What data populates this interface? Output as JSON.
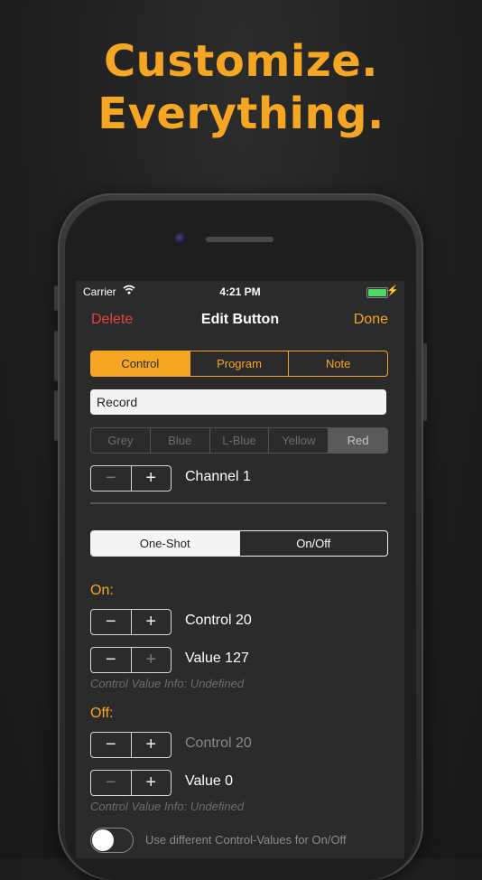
{
  "headline": {
    "line1": "Customize.",
    "line2": "Everything."
  },
  "status_bar": {
    "carrier": "Carrier",
    "time": "4:21 PM"
  },
  "nav": {
    "delete": "Delete",
    "title": "Edit Button",
    "done": "Done"
  },
  "type_tabs": {
    "items": [
      "Control",
      "Program",
      "Note"
    ],
    "selected": "Control"
  },
  "name_field": {
    "value": "Record"
  },
  "colors": {
    "items": [
      "Grey",
      "Blue",
      "L-Blue",
      "Yellow",
      "Red"
    ],
    "selected": "Red"
  },
  "channel": {
    "label": "Channel 1",
    "minus": "−",
    "plus": "+"
  },
  "mode": {
    "items": [
      "One-Shot",
      "On/Off"
    ],
    "selected": "One-Shot"
  },
  "on": {
    "title": "On:",
    "control_label": "Control 20",
    "value_label": "Value 127",
    "info": "Control Value Info: Undefined"
  },
  "off": {
    "title": "Off:",
    "control_label": "Control 20",
    "value_label": "Value 0",
    "info": "Control Value Info: Undefined"
  },
  "toggle": {
    "label": "Use different Control-Values for On/Off",
    "on": false
  },
  "theme": {
    "accent": "#f5a623",
    "destructive": "#e8443a",
    "background": "#2b2b2b"
  }
}
